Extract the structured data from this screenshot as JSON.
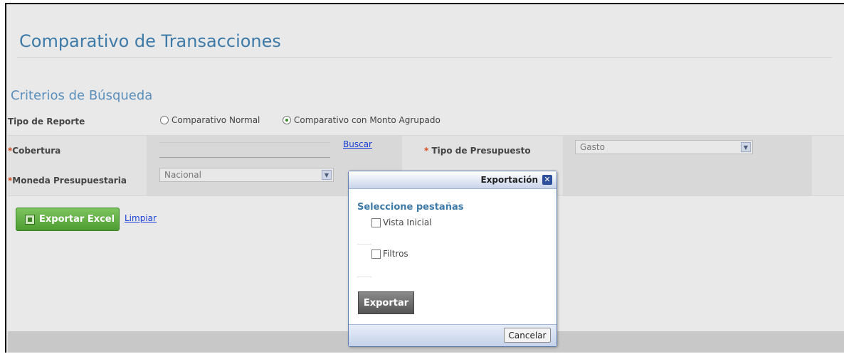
{
  "page": {
    "title": "Comparativo de Transacciones",
    "section_title": "Criterios de Búsqueda"
  },
  "form": {
    "report_type_label": "Tipo de Reporte",
    "radio_normal": "Comparativo Normal",
    "radio_grouped": "Comparativo con Monto Agrupado",
    "coverage_label": "Cobertura",
    "search_link": "Buscar",
    "budget_type_label": "Tipo de Presupuesto",
    "budget_type_value": "Gasto",
    "currency_label": "Moneda Presupuestaria",
    "currency_value": "Nacional",
    "required_mark": "*"
  },
  "actions": {
    "export_excel": "Exportar Excel",
    "clear": "Limpiar"
  },
  "modal": {
    "title": "Exportación",
    "close_glyph": "✕",
    "subtitle": "Seleccione pestañas",
    "option_1": "Vista Inicial",
    "option_2": "Filtros",
    "export_button": "Exportar",
    "cancel_button": "Cancelar"
  }
}
